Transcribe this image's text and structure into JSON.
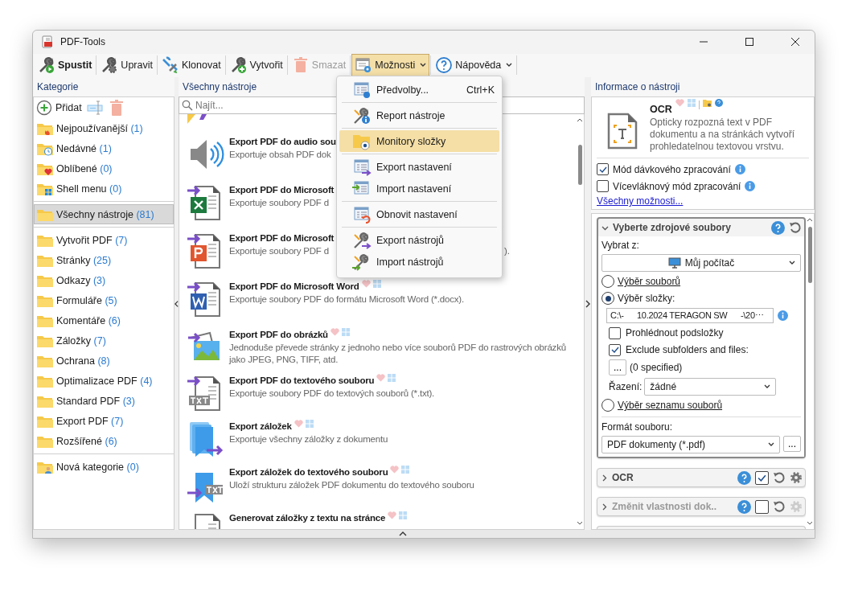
{
  "window": {
    "title": "PDF-Tools"
  },
  "toolbar": [
    {
      "label": "Spustit",
      "primary": true,
      "disabled": false,
      "pressed": false,
      "dropdown": false
    },
    {
      "label": "Upravit",
      "primary": false,
      "disabled": false,
      "pressed": false,
      "dropdown": false
    },
    {
      "label": "Klonovat",
      "primary": false,
      "disabled": false,
      "pressed": false,
      "dropdown": false
    },
    {
      "label": "Vytvořit",
      "primary": false,
      "disabled": false,
      "pressed": false,
      "dropdown": false
    },
    {
      "label": "Smazat",
      "primary": false,
      "disabled": true,
      "pressed": false,
      "dropdown": false
    },
    {
      "label": "Možnosti",
      "primary": false,
      "disabled": false,
      "pressed": true,
      "dropdown": true
    },
    {
      "label": "Nápověda",
      "primary": false,
      "disabled": false,
      "pressed": false,
      "dropdown": true
    }
  ],
  "categories": {
    "header": "Kategorie",
    "add_label": "Přidat",
    "groups": [
      [
        {
          "name": "Nejpoužívanější",
          "count": "(1)",
          "selected": false
        },
        {
          "name": "Nedávné",
          "count": "(1)",
          "selected": false
        },
        {
          "name": "Oblíbené",
          "count": "(0)",
          "selected": false
        },
        {
          "name": "Shell menu",
          "count": "(0)",
          "selected": false
        }
      ],
      [
        {
          "name": "Všechny nástroje",
          "count": "(81)",
          "selected": true
        }
      ],
      [
        {
          "name": "Vytvořit PDF",
          "count": "(7)",
          "selected": false
        },
        {
          "name": "Stránky",
          "count": "(25)",
          "selected": false
        },
        {
          "name": "Odkazy",
          "count": "(3)",
          "selected": false
        },
        {
          "name": "Formuláře",
          "count": "(5)",
          "selected": false
        },
        {
          "name": "Komentáře",
          "count": "(6)",
          "selected": false
        },
        {
          "name": "Záložky",
          "count": "(7)",
          "selected": false
        },
        {
          "name": "Ochrana",
          "count": "(8)",
          "selected": false
        },
        {
          "name": "Optimalizace PDF",
          "count": "(4)",
          "selected": false
        },
        {
          "name": "Standard PDF",
          "count": "(3)",
          "selected": false
        },
        {
          "name": "Export PDF",
          "count": "(7)",
          "selected": false
        },
        {
          "name": "Rozšířené",
          "count": "(6)",
          "selected": false
        }
      ],
      [
        {
          "name": "Nová kategorie",
          "count": "(0)",
          "selected": false
        }
      ]
    ]
  },
  "tools": {
    "header": "Všechny nástroje",
    "search_placeholder": "Najít...",
    "items": [
      {
        "title": "Export PDF do audio sou",
        "description": "Exportuje obsah PDF dok"
      },
      {
        "title": "Export PDF do Microsoft",
        "description": "Exportuje soubory PDF d"
      },
      {
        "title": "Export PDF do Microsoft",
        "description": "Exportuje soubory PDF d",
        "tail": ")."
      },
      {
        "title": "Export PDF do Microsoft Word",
        "description": "Exportuje soubory PDF do formátu Microsoft Word (*.docx).",
        "favorite": false,
        "shell_menu": false
      },
      {
        "title": "Export PDF do obrázků",
        "description": "Jednoduše převede stránky z jednoho nebo více souborů PDF do rastrových obrázků jako JPEG, PNG, TIFF, atd.",
        "favorite": false,
        "shell_menu": false
      },
      {
        "title": "Export PDF do textového souboru",
        "description": "Exportuje soubory PDF do textových souborů (*.txt).",
        "favorite": false,
        "shell_menu": false
      },
      {
        "title": "Export záložek",
        "description": "Exportuje všechny záložky z dokumentu",
        "favorite": false,
        "shell_menu": false
      },
      {
        "title": "Export záložek do textového souboru",
        "description": "Uloží strukturu záložek PDF dokumentu do textového souboru",
        "favorite": false,
        "shell_menu": false
      },
      {
        "title": "Generovat záložky z textu na stránce",
        "favorite": false,
        "shell_menu": false
      }
    ]
  },
  "menu": {
    "groups": [
      [
        {
          "label": "Předvolby...",
          "shortcut": "Ctrl+K",
          "selected": false
        }
      ],
      [
        {
          "label": "Report nástroje",
          "selected": false
        }
      ],
      [
        {
          "label": "Monitory složky",
          "selected": true
        }
      ],
      [
        {
          "label": "Export nastavení",
          "selected": false
        },
        {
          "label": "Import nastavení",
          "selected": false
        }
      ],
      [
        {
          "label": "Obnovit nastavení",
          "selected": false
        }
      ],
      [
        {
          "label": "Export nástrojů",
          "selected": false
        },
        {
          "label": "Import nástrojů",
          "selected": false
        }
      ]
    ]
  },
  "info": {
    "header": "Informace o nástroji",
    "title": "OCR",
    "favorite": false,
    "shell_menu": false,
    "description": "Opticky rozpozná text v PDF dokumentu a na stránkách vytvoří prohledatelnou textovou vrstvu.",
    "options": [
      {
        "label": "Mód dávkového zpracování",
        "checked": true
      },
      {
        "label": "Vícevláknový mód zpracování",
        "checked": false
      }
    ],
    "link": "Všechny možnosti..."
  },
  "sections": [
    {
      "title": "Vyberte zdrojové soubory",
      "expanded": true,
      "disabled": false
    },
    {
      "title": "OCR",
      "expanded": false,
      "disabled": false,
      "enabled": true
    },
    {
      "title": "Změnit vlastnosti dok..",
      "expanded": false,
      "disabled": true,
      "enabled": false
    }
  ],
  "source": {
    "from_label": "Vybrat z:",
    "from_value": "Můj počítač",
    "modes": [
      {
        "label": "Výběr souborů",
        "selected": false
      },
      {
        "label": "Výběr složky:",
        "selected": true
      },
      {
        "label": "Výběr seznamu souborů",
        "selected": false
      }
    ],
    "path": "C:\\-      10.2024 TERAGON SW      -\\20⋯",
    "subfolders": {
      "label": "Prohlédnout podsložky",
      "checked": false
    },
    "exclude": {
      "label": "Exclude subfolders and files:",
      "checked": true
    },
    "exclude_button": "...",
    "exclude_count": "(0 specified)",
    "sort_label": "Řazení:",
    "sort_value": "žádné",
    "format_label": "Formát souboru:",
    "format_value": "PDF dokumenty (*.pdf)",
    "format_button": "..."
  }
}
